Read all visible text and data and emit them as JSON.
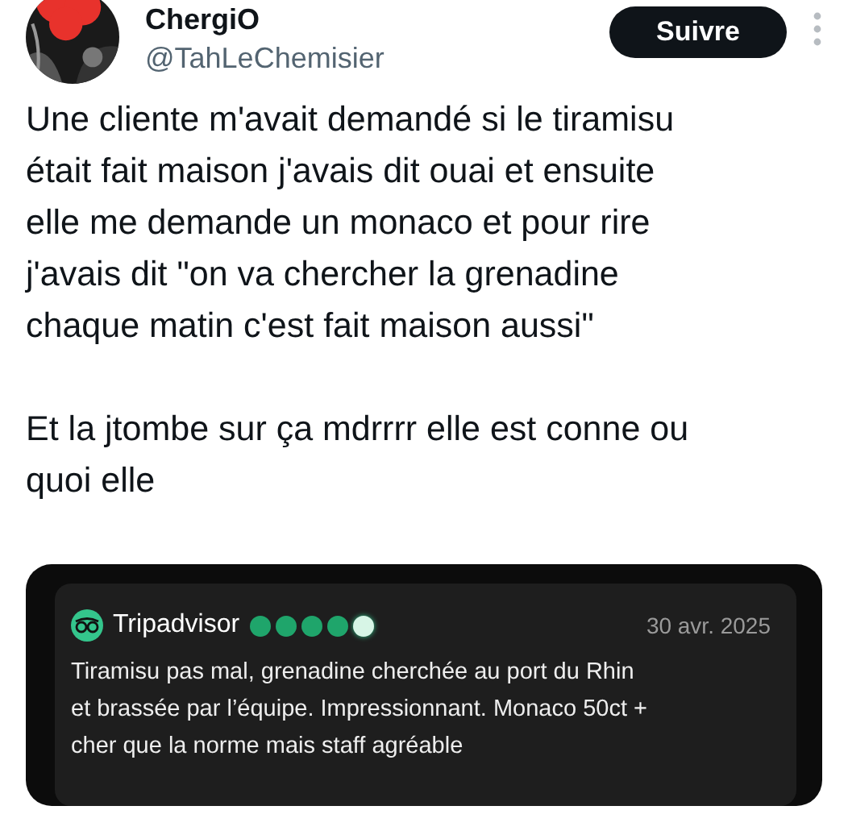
{
  "author": {
    "name": "ChergiO",
    "handle": "@TahLeChemisier"
  },
  "follow_button": "Suivre",
  "tweet_paragraphs": [
    "Une cliente m'avait demandé si le tiramisu\nétait fait maison j'avais dit ouai et ensuite\nelle me demande un monaco et pour rire\nj'avais dit \"on va chercher la grenadine\nchaque matin c'est fait maison aussi\"",
    "Et la jtombe sur ça mdrrrr elle est conne ou\nquoi elle"
  ],
  "review": {
    "site": "Tripadvisor",
    "stars": 4,
    "date": "30 avr. 2025",
    "text": "Tiramisu pas mal, grenadine cherchée au port du Rhin\net brassée par l’équipe. Impressionnant. Monaco 50ct +\ncher que la norme mais staff agréable"
  }
}
